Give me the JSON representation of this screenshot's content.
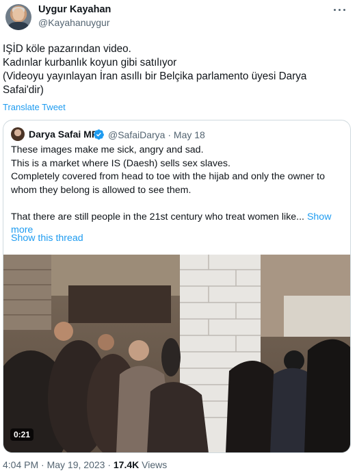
{
  "author": {
    "name": "Uygur Kayahan",
    "handle": "@Kayahanuygur"
  },
  "tweet": {
    "lines": [
      "IŞİD köle pazarından video.",
      "Kadınlar kurbanlık koyun gibi satılıyor",
      "(Videoyu yayınlayan İran asıllı bir Belçika parlamento üyesi Darya",
      "Safai'dir)"
    ],
    "translate_label": "Translate Tweet"
  },
  "quoted": {
    "name": "Darya Safai MP",
    "handle": "@SafaiDarya",
    "separator": "·",
    "date": "May 18",
    "lines": [
      "These images make me sick, angry and sad.",
      "This is a market where IS (Daesh) sells sex slaves.",
      "Completely covered from head to toe with the hijab and only the owner to",
      "whom they belong is allowed to see them."
    ],
    "last_line": "That there are still people in the 21st century who treat women like...",
    "show_more_1": "Show",
    "show_more_2": "more",
    "show_thread": "Show this thread",
    "video_duration": "0:21"
  },
  "footer": {
    "time": "4:04 PM",
    "separator": "·",
    "date": "May 19, 2023",
    "views_count": "17.4K",
    "views_label": "Views"
  },
  "icons": {
    "verified_color": "#1d9bf0",
    "link_color": "#1d9bf0"
  }
}
